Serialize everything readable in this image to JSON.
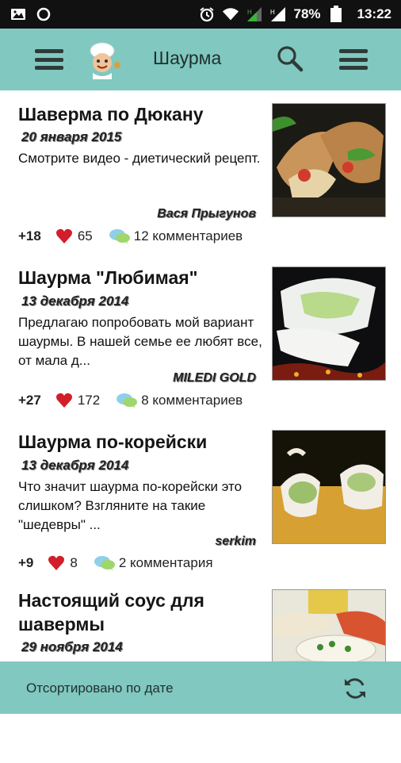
{
  "status_bar": {
    "battery": "78%",
    "time": "13:22",
    "icons": [
      "image-icon",
      "sync-icon",
      "alarm-icon",
      "wifi-icon",
      "signal-icon",
      "signal-2-icon",
      "battery-icon"
    ]
  },
  "app_bar": {
    "title": "Шаурма",
    "icons": [
      "menu-icon",
      "chef-logo-icon",
      "search-icon",
      "overflow-menu-icon"
    ]
  },
  "recipes": [
    {
      "title": "Шаверма по Дюкану",
      "date": "20 января 2015",
      "description": "Смотрите видео - диетический рецепт.",
      "author": "Вася Прыгунов",
      "rating": "+18",
      "likes": "65",
      "comments": "12 комментариев"
    },
    {
      "title": "Шаурма \"Любимая\"",
      "date": "13 декабря 2014",
      "description": "Предлагаю попробовать мой вариант шаурмы. В нашей семье ее любят все, от мала д...",
      "author": "MILEDI GOLD",
      "rating": "+27",
      "likes": "172",
      "comments": "8 комментариев"
    },
    {
      "title": "Шаурма по-корейски",
      "date": "13 декабря 2014",
      "description": "Что значит шаурма по-корейски это слишком? Взгляните на такие \"шедевры\" ...",
      "author": "serkim",
      "rating": "+9",
      "likes": "8",
      "comments": "2 комментария"
    },
    {
      "title": "Настоящий соус для шавермы",
      "date": "29 ноября 2014"
    }
  ],
  "footer": {
    "sort_label": "Отсортировано по дате",
    "icon": "refresh-icon"
  },
  "colors": {
    "accent": "#80c8c0",
    "status_bar": "#111111",
    "heart": "#d21e2b"
  }
}
